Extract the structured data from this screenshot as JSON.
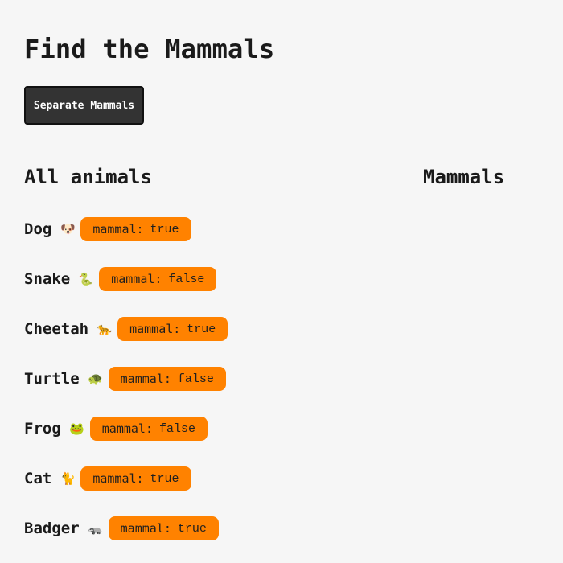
{
  "page": {
    "title": "Find the Mammals"
  },
  "toolbar": {
    "separate_label": "Separate Mammals"
  },
  "columns": {
    "all_heading": "All animals",
    "mammals_heading": "Mammals"
  },
  "animals": [
    {
      "name": "Dog",
      "emoji": "🐶",
      "key": "mammal:",
      "value": "true"
    },
    {
      "name": "Snake",
      "emoji": "🐍",
      "key": "mammal:",
      "value": "false"
    },
    {
      "name": "Cheetah",
      "emoji": "🐆",
      "key": "mammal:",
      "value": "true"
    },
    {
      "name": "Turtle",
      "emoji": "🐢",
      "key": "mammal:",
      "value": "false"
    },
    {
      "name": "Frog",
      "emoji": "🐸",
      "key": "mammal:",
      "value": "false"
    },
    {
      "name": "Cat",
      "emoji": "🐈",
      "key": "mammal:",
      "value": "true"
    },
    {
      "name": "Badger",
      "emoji": "🦡",
      "key": "mammal:",
      "value": "true"
    }
  ],
  "colors": {
    "background": "#f6f6f6",
    "button": "#333333",
    "badge": "#ff8200"
  }
}
